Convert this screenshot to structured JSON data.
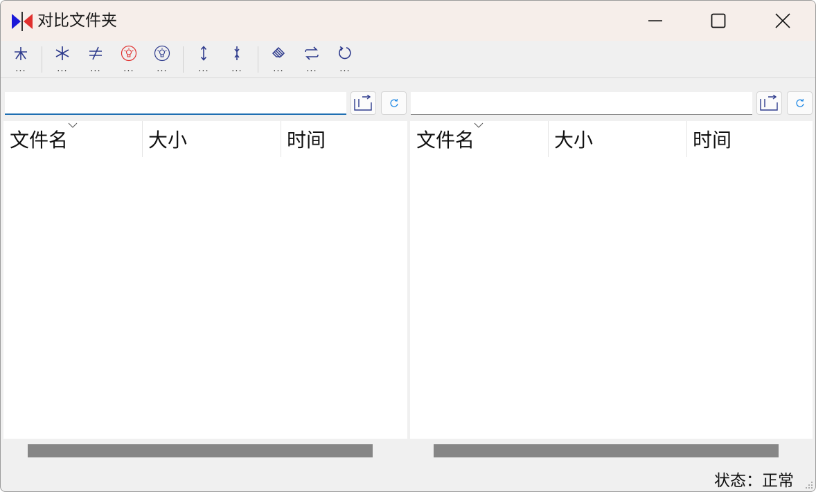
{
  "window": {
    "title": "对比文件夹",
    "icon": "compare-arrows-icon"
  },
  "toolbar": {
    "more_label": "...",
    "buttons": [
      {
        "icon": "branch-icon"
      },
      {
        "icon": "asterisk-icon"
      },
      {
        "icon": "not-equal-icon"
      },
      {
        "icon": "lightbulb-red-icon"
      },
      {
        "icon": "lightbulb-blue-icon"
      },
      {
        "icon": "expand-vertical-icon"
      },
      {
        "icon": "collapse-vertical-icon"
      },
      {
        "icon": "eraser-icon"
      },
      {
        "icon": "swap-icon"
      },
      {
        "icon": "refresh-icon"
      }
    ]
  },
  "left": {
    "path_value": "",
    "columns": [
      "文件名",
      "大小",
      "时间"
    ]
  },
  "right": {
    "path_value": "",
    "columns": [
      "文件名",
      "大小",
      "时间"
    ]
  },
  "status": "状态：正常",
  "colors": {
    "accent": "#1f6fb2",
    "icon_blue": "#2d3a8c",
    "red": "#e0302e",
    "titlebar": "#f6eeea"
  }
}
